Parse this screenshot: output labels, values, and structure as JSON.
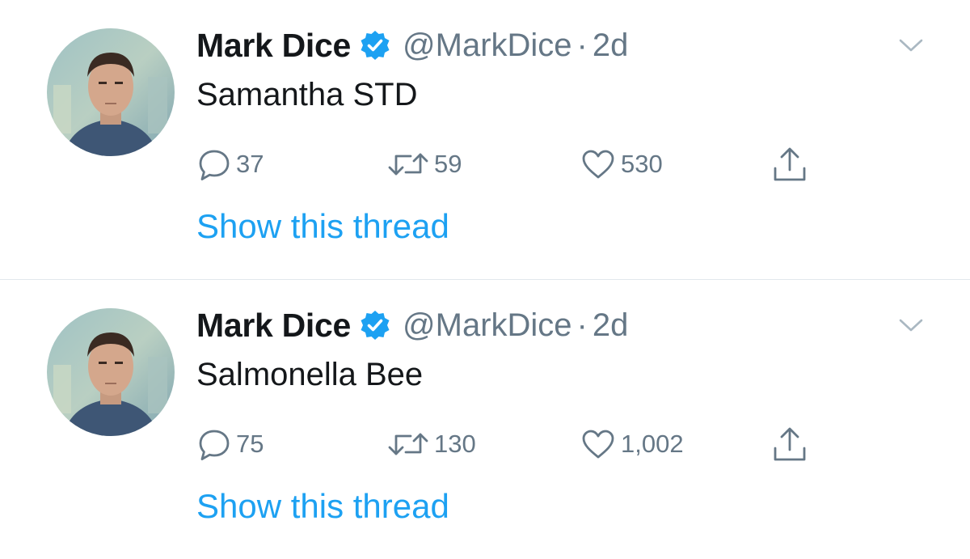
{
  "colors": {
    "text": "#14171a",
    "secondary": "#657786",
    "link": "#1da1f2",
    "verified": "#1da1f2",
    "divider": "#e1e8ed"
  },
  "icons": {
    "reply": "speech-bubble",
    "retweet": "retweet-arrows",
    "like": "heart-outline",
    "share": "upload-tray",
    "verified": "verified-badge-check",
    "menu": "chevron-down"
  },
  "tweets": [
    {
      "name": "Mark Dice",
      "handle": "@MarkDice",
      "separator": "·",
      "time": "2d",
      "text": "Samantha STD",
      "replies": "37",
      "retweets": "59",
      "likes": "530",
      "thread_link": "Show this thread"
    },
    {
      "name": "Mark Dice",
      "handle": "@MarkDice",
      "separator": "·",
      "time": "2d",
      "text": "Salmonella Bee",
      "replies": "75",
      "retweets": "130",
      "likes": "1,002",
      "thread_link": "Show this thread"
    }
  ]
}
